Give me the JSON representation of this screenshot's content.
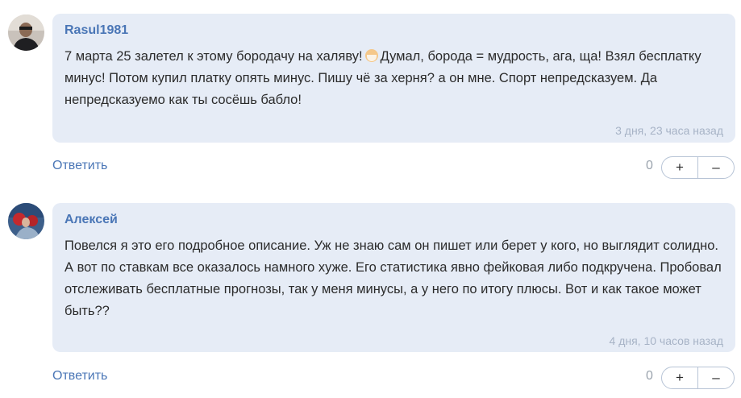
{
  "comments": [
    {
      "author": "Rasul1981",
      "text_before_emoji": "7 марта 25 залетел к этому бородачу на халяву!",
      "emoji_icon": "old-man-face-emoji",
      "text_after_emoji": "Думал, борода = мудрость, ага, ща! Взял бесплатку минус! Потом купил платку опять минус. Пишу чё за херня? а он мне. Спорт непредсказуем. Да непредсказуемо как ты сосёшь бабло!",
      "time": "3 дня, 23 часа назад",
      "reply_label": "Ответить",
      "score": "0",
      "plus_label": "+",
      "minus_label": "–"
    },
    {
      "author": "Алексей",
      "text": "Повелся я это его подробное описание. Уж не знаю сам он пишет или берет у кого, но выглядит солидно. А вот по ставкам все оказалось намного хуже. Его статистика явно фейковая либо подкручена. Пробовал отслеживать бесплатные прогнозы, так у меня минусы, а у него по итогу плюсы. Вот и как такое может быть??",
      "time": "4 дня, 10 часов назад",
      "reply_label": "Ответить",
      "score": "0",
      "plus_label": "+",
      "minus_label": "–"
    }
  ],
  "colors": {
    "bubble_bg": "#e6ecf6",
    "author": "#4a76b6",
    "link": "#4a76b6",
    "time": "#a7b3c6"
  }
}
